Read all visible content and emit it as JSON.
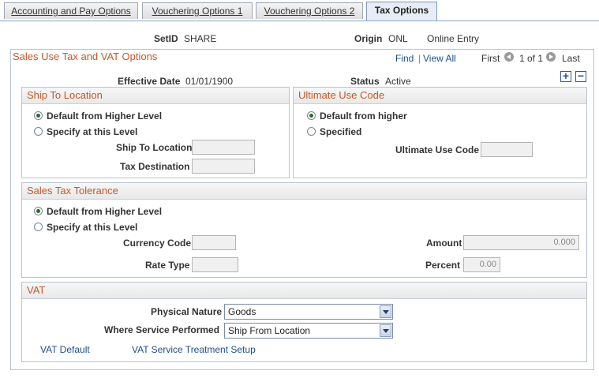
{
  "tabs": [
    {
      "label": "Accounting and Pay Options"
    },
    {
      "label": "Vouchering Options 1"
    },
    {
      "label": "Vouchering Options 2"
    },
    {
      "label": "Tax Options"
    }
  ],
  "header": {
    "setid_label": "SetID",
    "setid_value": "SHARE",
    "origin_label": "Origin",
    "origin_value": "ONL",
    "origin_desc": "Online Entry"
  },
  "main": {
    "title": "Sales Use Tax and VAT Options",
    "nav": {
      "find": "Find",
      "separator": "|",
      "view_all": "View All",
      "first": "First",
      "range": "1 of 1",
      "last": "Last"
    },
    "effective_date_label": "Effective Date",
    "effective_date_value": "01/01/1900",
    "status_label": "Status",
    "status_value": "Active",
    "add_icon": "plus-icon",
    "delete_icon": "minus-icon"
  },
  "ship_to": {
    "title": "Ship To Location",
    "options": [
      {
        "label": "Default from Higher Level",
        "selected": true
      },
      {
        "label": "Specify at this Level",
        "selected": false
      }
    ],
    "ship_to_location_label": "Ship To Location",
    "ship_to_location_value": "",
    "tax_destination_label": "Tax Destination",
    "tax_destination_value": ""
  },
  "ultimate_use": {
    "title": "Ultimate Use Code",
    "options": [
      {
        "label": "Default from higher",
        "selected": true
      },
      {
        "label": "Specified",
        "selected": false
      }
    ],
    "code_label": "Ultimate Use Code",
    "code_value": ""
  },
  "tolerance": {
    "title": "Sales Tax Tolerance",
    "options": [
      {
        "label": "Default from Higher Level",
        "selected": true
      },
      {
        "label": "Specify at this Level",
        "selected": false
      }
    ],
    "currency_code_label": "Currency Code",
    "currency_code_value": "",
    "rate_type_label": "Rate Type",
    "rate_type_value": "",
    "amount_label": "Amount",
    "amount_value": "0.000",
    "percent_label": "Percent",
    "percent_value": "0.00"
  },
  "vat": {
    "title": "VAT",
    "physical_nature_label": "Physical Nature",
    "physical_nature_value": "Goods",
    "where_service_label": "Where Service Performed",
    "where_service_value": "Ship From Location",
    "link_default": "VAT Default",
    "link_service": "VAT Service Treatment Setup"
  },
  "colors": {
    "section_title": "#c05a2a",
    "link": "#1f4e8c",
    "radio_selected": "#2a6b2a"
  }
}
